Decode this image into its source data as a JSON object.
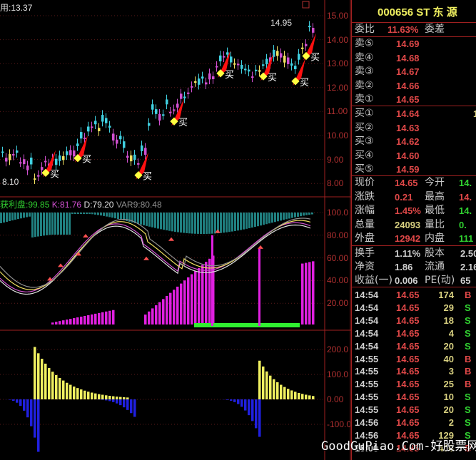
{
  "price_header": {
    "label": "用:13.37",
    "high_marker": "14.95",
    "low_marker": "8.10",
    "buy_label": "买"
  },
  "indicator_header": {
    "profit": "获利盘:99.85",
    "k": "K:81.76",
    "d": "D:79.20",
    "var9": "VAR9:80.48"
  },
  "axes": {
    "price": [
      "15.00",
      "14.00",
      "13.00",
      "12.00",
      "11.00",
      "10.00",
      "9.00",
      "8.00"
    ],
    "kdj": [
      "100.0",
      "80.00",
      "60.00",
      "40.00",
      "20.00"
    ],
    "macd": [
      "200.0",
      "100.0",
      "0.00",
      "-100.0"
    ]
  },
  "quote": {
    "title": "000656 ST 东 源",
    "weibi_label": "委比",
    "weibi_value": "11.63%",
    "weicha_label": "委差",
    "sell": [
      {
        "l": "卖⑤",
        "p": "14.69"
      },
      {
        "l": "卖④",
        "p": "14.68"
      },
      {
        "l": "卖③",
        "p": "14.67"
      },
      {
        "l": "卖②",
        "p": "14.66"
      },
      {
        "l": "卖①",
        "p": "14.65"
      }
    ],
    "buy": [
      {
        "l": "买①",
        "p": "14.64",
        "v": "1"
      },
      {
        "l": "买②",
        "p": "14.63"
      },
      {
        "l": "买③",
        "p": "14.62"
      },
      {
        "l": "买④",
        "p": "14.60"
      },
      {
        "l": "买⑤",
        "p": "14.59"
      }
    ],
    "stats": [
      {
        "l1": "现价",
        "v1": "14.65",
        "l2": "今开",
        "v2": "14."
      },
      {
        "l1": "涨跌",
        "v1": "0.21",
        "l2": "最高",
        "v2": "14."
      },
      {
        "l1": "涨幅",
        "v1": "1.45%",
        "l2": "最低",
        "v2": "14."
      },
      {
        "l1": "总量",
        "v1": "24093",
        "l2": "量比",
        "v2": "0."
      },
      {
        "l1": "外盘",
        "v1": "12942",
        "l2": "内盘",
        "v2": "111"
      }
    ],
    "fin": [
      {
        "l1": "换手",
        "v1": "1.11%",
        "l2": "股本",
        "v2": "2.50"
      },
      {
        "l1": "净资",
        "v1": "1.86",
        "l2": "流通",
        "v2": "2.16"
      },
      {
        "l1": "收益(一)",
        "v1": "0.006",
        "l2": "PE(动)",
        "v2": "65"
      }
    ]
  },
  "trades": [
    {
      "t": "14:54",
      "p": "14.65",
      "v": "174",
      "s": "B"
    },
    {
      "t": "14:54",
      "p": "14.65",
      "v": "29",
      "s": "S"
    },
    {
      "t": "14:54",
      "p": "14.65",
      "v": "18",
      "s": "S"
    },
    {
      "t": "14:54",
      "p": "14.65",
      "v": "4",
      "s": "S"
    },
    {
      "t": "14:54",
      "p": "14.65",
      "v": "20",
      "s": "S"
    },
    {
      "t": "14:55",
      "p": "14.65",
      "v": "40",
      "s": "B"
    },
    {
      "t": "14:55",
      "p": "14.65",
      "v": "3",
      "s": "B"
    },
    {
      "t": "14:55",
      "p": "14.65",
      "v": "25",
      "s": "B"
    },
    {
      "t": "14:55",
      "p": "14.65",
      "v": "10",
      "s": "S"
    },
    {
      "t": "14:55",
      "p": "14.65",
      "v": "20",
      "s": "S"
    },
    {
      "t": "14:56",
      "p": "14.65",
      "v": "2",
      "s": "S"
    },
    {
      "t": "14:56",
      "p": "14.65",
      "v": "129",
      "s": "S"
    },
    {
      "t": "15:00",
      "p": "14.65",
      "v": "400",
      "s": "B"
    }
  ],
  "watermark": "GoodGuPiao.Com-好股票网",
  "chart_data": {
    "type": "candlestick",
    "price_keypoints": [
      [
        0,
        9.3
      ],
      [
        5,
        9.1
      ],
      [
        9,
        8.4
      ],
      [
        14,
        8.9
      ],
      [
        20,
        9.4
      ],
      [
        26,
        10.6
      ],
      [
        30,
        10.2
      ],
      [
        34,
        9.6
      ],
      [
        38,
        8.8
      ],
      [
        40,
        9.6
      ],
      [
        42,
        11.0
      ],
      [
        48,
        11.2
      ],
      [
        52,
        12.0
      ],
      [
        58,
        12.4
      ],
      [
        62,
        13.3
      ],
      [
        66,
        12.8
      ],
      [
        70,
        12.3
      ],
      [
        74,
        13.0
      ],
      [
        78,
        13.6
      ],
      [
        82,
        12.9
      ],
      [
        87,
        14.7
      ]
    ],
    "buy_signals": [
      12,
      21,
      38,
      48,
      61,
      73,
      82,
      85
    ],
    "kdj_magenta": [
      [
        14,
        31,
        3,
        14
      ],
      [
        40,
        59,
        10,
        62
      ],
      [
        84,
        87,
        55,
        57
      ]
    ],
    "macd_pos": [
      [
        9,
        35,
        210,
        0.88
      ]
    ],
    "macd_pos2": [
      [
        72,
        87,
        155,
        0.85
      ]
    ],
    "macd_neg": [
      [
        0,
        10,
        -210,
        0.8
      ],
      [
        24,
        37,
        -70,
        0.85
      ],
      [
        60,
        72,
        -150,
        0.88
      ]
    ],
    "kdj_last": {
      "profit": 99.85,
      "k": 81.76,
      "d": 79.2,
      "var9": 80.48
    }
  }
}
